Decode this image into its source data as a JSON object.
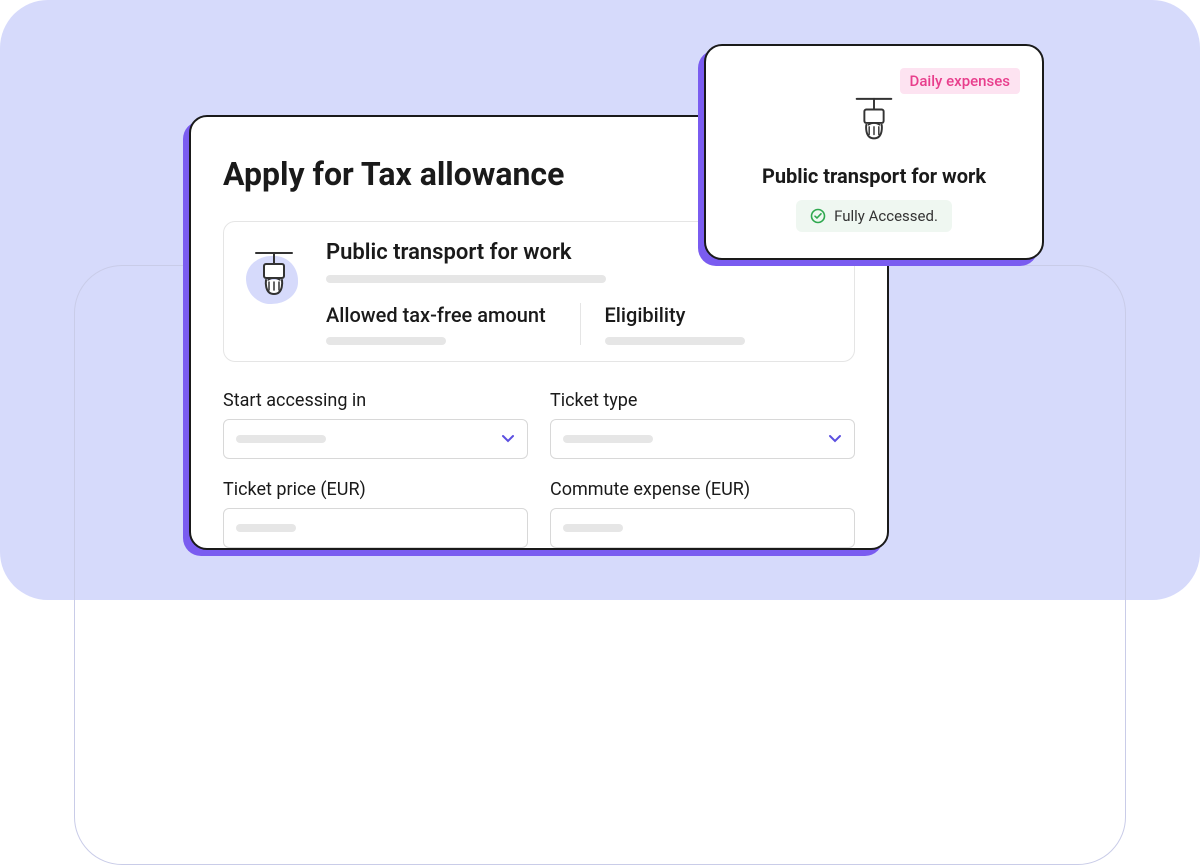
{
  "main": {
    "title": "Apply for Tax allowance",
    "info": {
      "heading": "Public transport for work",
      "allowed_label": "Allowed tax-free amount",
      "eligibility_label": "Eligibility"
    },
    "fields": {
      "start_label": "Start accessing in",
      "ticket_type_label": "Ticket type",
      "ticket_price_label": "Ticket price (EUR)",
      "commute_expense_label": "Commute expense (EUR)"
    }
  },
  "popup": {
    "badge": "Daily expenses",
    "title": "Public transport for work",
    "status": "Fully Accessed."
  },
  "icons": {
    "handle": "transit-handle-icon",
    "chevron": "chevron-down-icon",
    "check": "check-circle-icon"
  },
  "colors": {
    "accent": "#7A5CF0",
    "badge_bg": "#FDE3F1",
    "badge_text": "#E83E8C",
    "status_bg": "#EFF7F1",
    "check": "#2FA84F"
  }
}
